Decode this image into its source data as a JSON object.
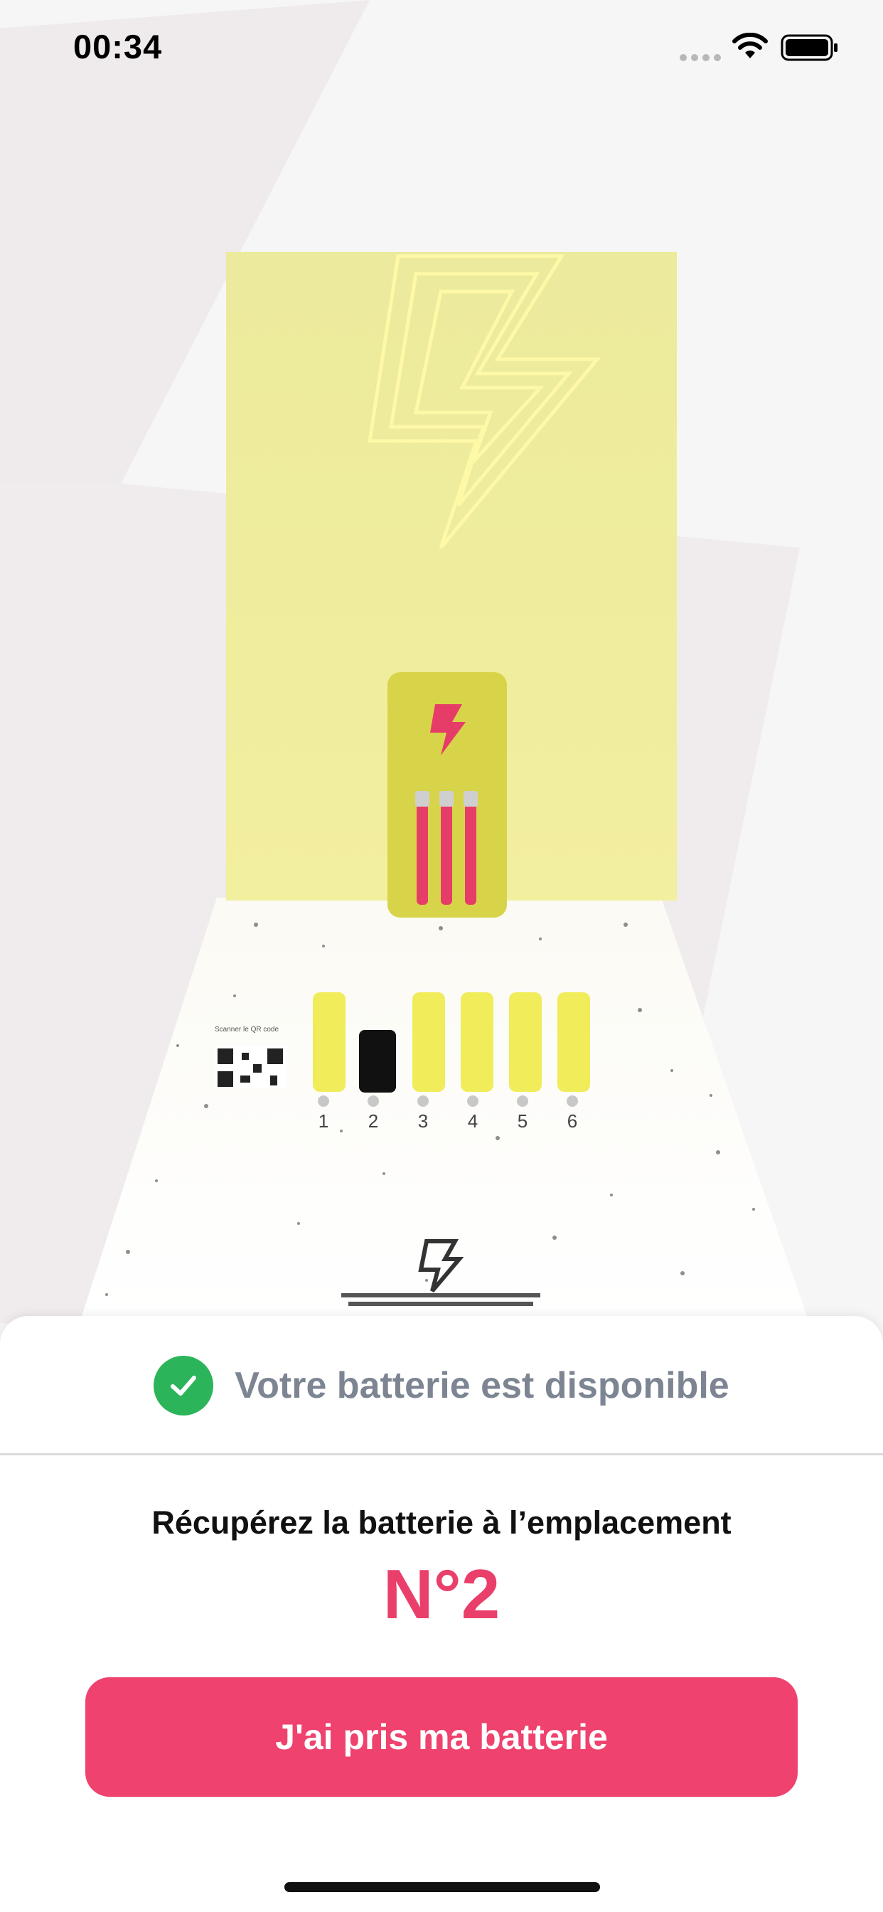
{
  "status_bar": {
    "time": "00:34",
    "icons": [
      "signal-dots-icon",
      "wifi-icon",
      "battery-icon"
    ]
  },
  "station": {
    "slots": [
      "1",
      "2",
      "3",
      "4",
      "5",
      "6"
    ],
    "empty_slot": "2",
    "qr_label": "Scanner le QR code"
  },
  "sheet": {
    "status_message": "Votre batterie est disponible",
    "instruction": "Récupérez la batterie à l’emplacement",
    "slot_number": "N°2",
    "confirm_button": "J'ai pris ma batterie"
  },
  "colors": {
    "accent": "#ef426e",
    "success": "#2cb45a",
    "muted_text": "#7d8592",
    "station_yellow": "#f2ef9a"
  }
}
